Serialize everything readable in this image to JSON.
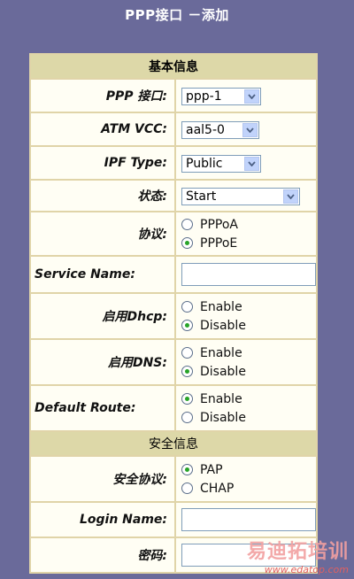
{
  "page": {
    "title": "PPP接口 －添加"
  },
  "sections": {
    "basic": "基本信息",
    "security": "安全信息"
  },
  "fields": {
    "ppp_interface": {
      "label": "PPP 接口:",
      "value": "ppp-1"
    },
    "atm_vcc": {
      "label": "ATM VCC:",
      "value": "aal5-0"
    },
    "ipf_type": {
      "label": "IPF Type:",
      "value": "Public"
    },
    "status": {
      "label": "状态:",
      "value": "Start"
    },
    "protocol": {
      "label": "协议:",
      "options": [
        "PPPoA",
        "PPPoE"
      ],
      "selected": "PPPoE"
    },
    "service_name": {
      "label": "Service Name:",
      "value": ""
    },
    "enable_dhcp": {
      "label": "启用Dhcp:",
      "options": [
        "Enable",
        "Disable"
      ],
      "selected": "Disable"
    },
    "enable_dns": {
      "label": "启用DNS:",
      "options": [
        "Enable",
        "Disable"
      ],
      "selected": "Disable"
    },
    "default_route": {
      "label": "Default Route:",
      "options": [
        "Enable",
        "Disable"
      ],
      "selected": "Enable"
    },
    "security_protocol": {
      "label": "安全协议:",
      "options": [
        "PAP",
        "CHAP"
      ],
      "selected": "PAP"
    },
    "login_name": {
      "label": "Login Name:",
      "value": ""
    },
    "password": {
      "label": "密码:",
      "value": ""
    }
  },
  "watermark": {
    "text": "易迪拓培训",
    "url": "www.edatop.com"
  },
  "colors": {
    "background": "#6a6a9a",
    "section_header": "#ddd8a8",
    "radio_selected": "#28a428"
  }
}
